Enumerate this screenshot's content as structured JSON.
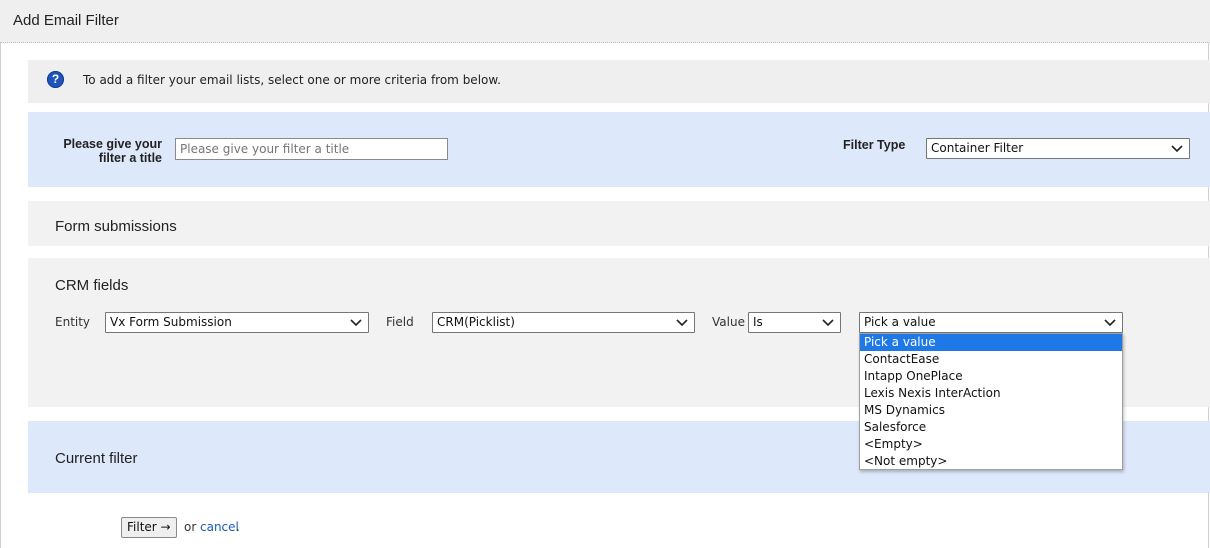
{
  "window": {
    "title": "Add Email Filter"
  },
  "info": {
    "icon": "help-icon",
    "message": "To add a filter your email lists, select one or more criteria from below."
  },
  "title_panel": {
    "title_label_line1": "Please give your",
    "title_label_line2": "filter a title",
    "title_placeholder": "Please give your filter a title",
    "title_value": "",
    "type_label": "Filter Type",
    "type_value": "Container Filter"
  },
  "form_section": {
    "heading": "Form submissions"
  },
  "crm_section": {
    "heading": "CRM fields",
    "entity_label": "Entity",
    "entity_value": "Vx Form Submission",
    "field_label": "Field",
    "field_value": "CRM(Picklist)",
    "value_label": "Value",
    "operator_value": "Is",
    "value_select": "Pick a value",
    "value_options": [
      "Pick a value",
      "ContactEase",
      "Intapp OnePlace",
      "Lexis Nexis InterAction",
      "MS Dynamics",
      "Salesforce",
      "<Empty>",
      "<Not empty>"
    ],
    "selected_option_index": 0
  },
  "current_section": {
    "heading": "Current filter"
  },
  "actions": {
    "filter_button": "Filter →",
    "or_text": "or",
    "cancel_link": "cancel",
    "trailing": "."
  },
  "colors": {
    "accent": "#1e78e6",
    "panel_blue": "#dde8fb",
    "panel_gray": "#f2f2f2",
    "link": "#1a5bb8",
    "help_icon": "#1f55b8"
  }
}
